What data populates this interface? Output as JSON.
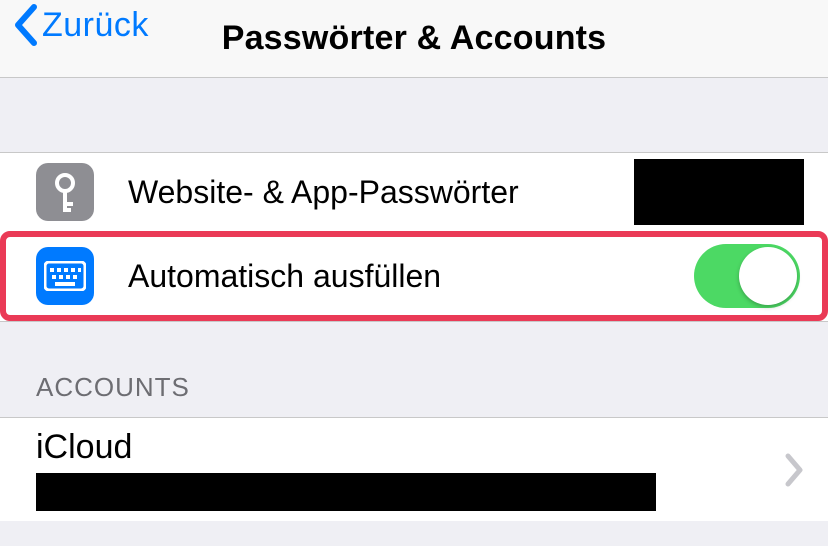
{
  "nav": {
    "back_label": "Zurück",
    "title": "Passwörter & Accounts"
  },
  "rows": {
    "passwords_label": "Website- & App-Passwörter",
    "autofill_label": "Automatisch ausfüllen",
    "autofill_on": true
  },
  "section": {
    "accounts_header": "ACCOUNTS",
    "icloud_title": "iCloud"
  }
}
